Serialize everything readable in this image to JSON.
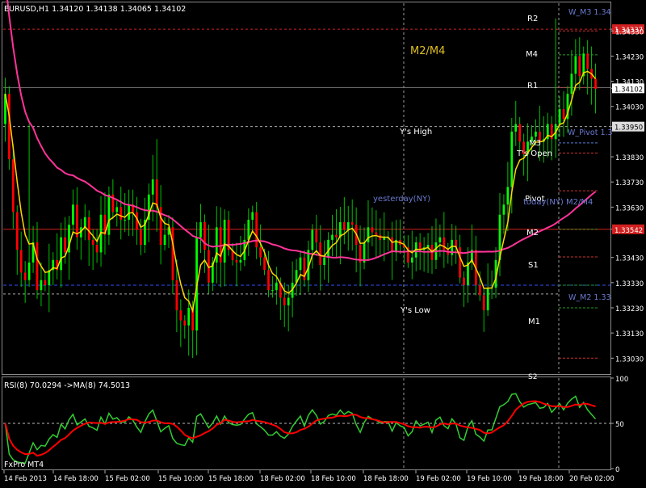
{
  "window": {
    "title": "EURUSD,H1  1.34120 1.34138 1.34065 1.34102",
    "broker": "FxPro MT4"
  },
  "colors": {
    "background": "#000000",
    "grid": "#888888",
    "bull_candle": "#00FF00",
    "bear_candle": "#FF0000",
    "wick": "#00C000",
    "ma_fast": "#FFD700",
    "ma_slow": "#FF3399",
    "rsi": "#32CD32",
    "rsi_ma": "#FF0000",
    "level_text": "#FFFFFF",
    "blue_line": "#2F4FFF",
    "red_line": "#D22020",
    "annotation_yellow": "#E0C020",
    "annotation_blue": "#6A7AD0"
  },
  "chart_data": [
    {
      "type": "candlestick",
      "title": "EURUSD,H1",
      "ylim": [
        1.3297,
        1.3444
      ],
      "y_ticks": [
        "1.34337",
        "1.34330",
        "1.34230",
        "1.34130",
        "1.34102",
        "1.34030",
        "1.33950",
        "1.33830",
        "1.33730",
        "1.33630",
        "1.33542",
        "1.33430",
        "1.33330",
        "1.33230",
        "1.33130",
        "1.33030"
      ],
      "y_tick_values": [
        1.34337,
        1.3433,
        1.3423,
        1.3413,
        1.34102,
        1.3403,
        1.3395,
        1.3383,
        1.3373,
        1.3363,
        1.33542,
        1.3343,
        1.3333,
        1.3323,
        1.3313,
        1.3303
      ],
      "x_ticks": [
        "14 Feb 2013",
        "14 Feb 18:00",
        "15 Feb 02:00",
        "15 Feb 10:00",
        "15 Feb 18:00",
        "18 Feb 02:00",
        "18 Feb 10:00",
        "18 Feb 18:00",
        "19 Feb 02:00",
        "19 Feb 10:00",
        "19 Feb 18:00",
        "20 Feb 02:00"
      ],
      "tags": {
        "top_red": "1.34337",
        "current": "1.34102",
        "ys_high": "1.33950",
        "m2_red": "1.33542",
        "blue_low": "1.33320"
      },
      "levels": {
        "r2": "R2",
        "m4": "M4",
        "r1": "R1",
        "ys_high": "Y's High",
        "m3": "M3",
        "ts_open": "T's Open",
        "pivot": "Pivot",
        "m2": "M2",
        "s1": "S1",
        "ys_low": "Y's Low",
        "m1": "M1",
        "s2": "S2",
        "w_m3": "W_M3 1.34",
        "w_pivot": "W_Pivot 1.3",
        "w_m2": "W_M2 1.33",
        "m2_m4": "M2/M4",
        "yesterday": "yesterday(NY)",
        "today": "today(NY) M2/M4"
      },
      "level_values": {
        "r2": 1.3433,
        "m4": 1.34235,
        "r1": 1.34105,
        "ys_high": 1.3395,
        "m3": 1.33885,
        "ts_open": 1.33845,
        "pivot": 1.33695,
        "m2": 1.33542,
        "s1": 1.33432,
        "w_m2": 1.3332,
        "ys_low": 1.33285,
        "m1": 1.3323,
        "s2": 1.3303
      },
      "series": [
        {
          "name": "close",
          "values": [
            1.3408,
            1.3382,
            1.3361,
            1.3346,
            1.3337,
            1.3334,
            1.3341,
            1.3349,
            1.333,
            1.3334,
            1.3332,
            1.3338,
            1.3342,
            1.3338,
            1.3351,
            1.3345,
            1.3356,
            1.3364,
            1.3351,
            1.3355,
            1.3359,
            1.335,
            1.3348,
            1.3345,
            1.336,
            1.3352,
            1.3368,
            1.3361,
            1.3363,
            1.3358,
            1.3358,
            1.3364,
            1.3361,
            1.3354,
            1.3348,
            1.3358,
            1.3368,
            1.3374,
            1.3363,
            1.3348,
            1.3352,
            1.3355,
            1.3334,
            1.3322,
            1.3318,
            1.3316,
            1.3323,
            1.3314,
            1.3351,
            1.3357,
            1.3346,
            1.3333,
            1.3341,
            1.3355,
            1.3341,
            1.3358,
            1.3346,
            1.3342,
            1.3341,
            1.3342,
            1.335,
            1.3358,
            1.3361,
            1.3347,
            1.3343,
            1.3338,
            1.333,
            1.333,
            1.3333,
            1.3327,
            1.3324,
            1.3327,
            1.3333,
            1.3338,
            1.3343,
            1.3334,
            1.3346,
            1.3354,
            1.3349,
            1.334,
            1.3343,
            1.335,
            1.3352,
            1.3351,
            1.3357,
            1.3354,
            1.3357,
            1.3356,
            1.3348,
            1.3341,
            1.3349,
            1.3355,
            1.3353,
            1.3352,
            1.335,
            1.3351,
            1.3351,
            1.3345,
            1.335,
            1.3348,
            1.3347,
            1.3341,
            1.3343,
            1.3349,
            1.3346,
            1.3347,
            1.3348,
            1.3342,
            1.3349,
            1.3351,
            1.3346,
            1.3344,
            1.335,
            1.3347,
            1.3335,
            1.3332,
            1.3341,
            1.3346,
            1.3332,
            1.3328,
            1.3322,
            1.3331,
            1.3331,
            1.3342,
            1.336,
            1.3364,
            1.3371,
            1.3393,
            1.3396,
            1.3389,
            1.3384,
            1.3389,
            1.3391,
            1.3393,
            1.3389,
            1.339,
            1.3396,
            1.339,
            1.3396,
            1.3402,
            1.3398,
            1.3408,
            1.3416,
            1.3423,
            1.3415,
            1.3424,
            1.3418,
            1.3414,
            1.341
          ]
        },
        {
          "name": "ma_fast",
          "values": []
        },
        {
          "name": "ma_slow",
          "values": []
        }
      ]
    },
    {
      "type": "line",
      "title": "RSI(8) 70.0294  ->MA(8) 74.5013",
      "ylim": [
        0,
        100
      ],
      "y_ticks": [
        "100",
        "50",
        "0"
      ],
      "reference_line": 50,
      "series": [
        {
          "name": "RSI(8)",
          "values": []
        },
        {
          "name": "MA(8)",
          "values": []
        }
      ]
    }
  ]
}
